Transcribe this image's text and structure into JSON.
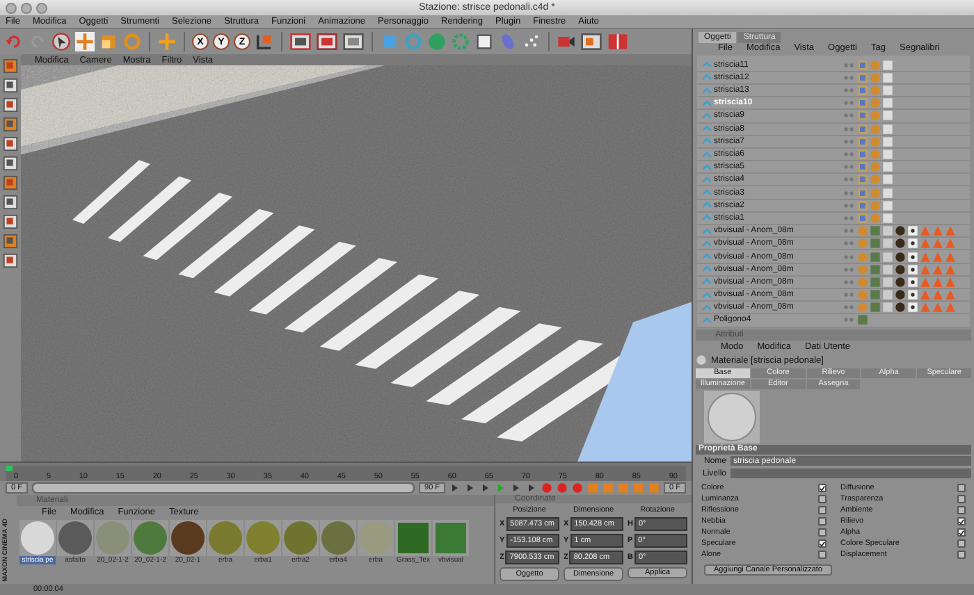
{
  "window": {
    "title": "Stazione: strisce pedonali.c4d *"
  },
  "menu": [
    "File",
    "Modifica",
    "Oggetti",
    "Strumenti",
    "Selezione",
    "Struttura",
    "Funzioni",
    "Animazione",
    "Personaggio",
    "Rendering",
    "Plugin",
    "Finestre",
    "Aiuto"
  ],
  "toolbar": {
    "axes": [
      "X",
      "Y",
      "Z"
    ]
  },
  "viewport": {
    "menu": [
      "Modifica",
      "Camere",
      "Mostra",
      "Filtro",
      "Vista"
    ]
  },
  "objects": {
    "tabs": [
      {
        "label": "Oggetti",
        "selected": true
      },
      {
        "label": "Struttura",
        "selected": false
      }
    ],
    "menu": [
      "File",
      "Modifica",
      "Vista",
      "Oggetti",
      "Tag",
      "Segnalibri"
    ],
    "rows": [
      {
        "name": "striscia11",
        "kind": "stripe",
        "selected": false
      },
      {
        "name": "striscia12",
        "kind": "stripe",
        "selected": false
      },
      {
        "name": "striscia13",
        "kind": "stripe",
        "selected": false
      },
      {
        "name": "striscia10",
        "kind": "stripe",
        "selected": true
      },
      {
        "name": "striscia9",
        "kind": "stripe",
        "selected": false
      },
      {
        "name": "striscia8",
        "kind": "stripe",
        "selected": false
      },
      {
        "name": "striscia7",
        "kind": "stripe",
        "selected": false
      },
      {
        "name": "striscia6",
        "kind": "stripe",
        "selected": false
      },
      {
        "name": "striscia5",
        "kind": "stripe",
        "selected": false
      },
      {
        "name": "striscia4",
        "kind": "stripe",
        "selected": false
      },
      {
        "name": "striscia3",
        "kind": "stripe",
        "selected": false
      },
      {
        "name": "striscia2",
        "kind": "stripe",
        "selected": false
      },
      {
        "name": "striscia1",
        "kind": "stripe",
        "selected": false
      },
      {
        "name": "vbvisual - Anom_08m",
        "kind": "plant",
        "selected": false
      },
      {
        "name": "vbvisual - Anom_08m",
        "kind": "plant",
        "selected": false
      },
      {
        "name": "vbvisual - Anom_08m",
        "kind": "plant",
        "selected": false
      },
      {
        "name": "vbvisual - Anom_08m",
        "kind": "plant",
        "selected": false
      },
      {
        "name": "vbvisual - Anom_08m",
        "kind": "plant",
        "selected": false
      },
      {
        "name": "vbvisual - Anom_08m",
        "kind": "plant",
        "selected": false
      },
      {
        "name": "vbvisual - Anom_08m",
        "kind": "plant",
        "selected": false
      },
      {
        "name": "Poligono4",
        "kind": "polygon",
        "selected": false
      }
    ]
  },
  "attributes": {
    "title": "Attributi",
    "menu": [
      "Modo",
      "Modifica",
      "Dati Utente"
    ],
    "heading": "Materiale [striscia pedonale]",
    "tabs": [
      {
        "label": "Base",
        "selected": true
      },
      {
        "label": "Colore",
        "selected": false
      },
      {
        "label": "Rilievo",
        "selected": false
      },
      {
        "label": "Alpha",
        "selected": false
      },
      {
        "label": "Speculare",
        "selected": false
      },
      {
        "label": "Illuminazione",
        "selected": false
      },
      {
        "label": "Editor",
        "selected": false
      },
      {
        "label": "Assegna",
        "selected": false
      }
    ],
    "section": "Proprietà Base",
    "name_label": "Nome",
    "name_value": "striscia pedonale",
    "layer_label": "Livello",
    "channels": [
      {
        "label": "Colore",
        "checked": true
      },
      {
        "label": "Diffusione",
        "checked": false
      },
      {
        "label": "Luminanza",
        "checked": false
      },
      {
        "label": "Trasparenza",
        "checked": false
      },
      {
        "label": "Riflessione",
        "checked": false
      },
      {
        "label": "Ambiente",
        "checked": false
      },
      {
        "label": "Nebbia",
        "checked": false
      },
      {
        "label": "Rilievo",
        "checked": true
      },
      {
        "label": "Normale",
        "checked": false
      },
      {
        "label": "Alpha",
        "checked": true
      },
      {
        "label": "Speculare",
        "checked": true
      },
      {
        "label": "Colore Speculare",
        "checked": false
      },
      {
        "label": "Alone",
        "checked": false
      },
      {
        "label": "Displacement",
        "checked": false
      }
    ],
    "button": "Aggiungi Canale Personalizzato"
  },
  "timeline": {
    "ticks": [
      "0",
      "5",
      "10",
      "15",
      "20",
      "25",
      "30",
      "35",
      "40",
      "45",
      "50",
      "55",
      "60",
      "65",
      "70",
      "75",
      "80",
      "85",
      "90"
    ],
    "level": 0,
    "range": {
      "level": 1
    },
    "start": "0 F",
    "end": "90 F",
    "current": "0 F"
  },
  "materials": {
    "title": "Materiali",
    "menu": [
      "File",
      "Modifica",
      "Funzione",
      "Texture"
    ],
    "items": [
      {
        "label": "striscia pe",
        "color": "#d8d8d8",
        "selected": true
      },
      {
        "label": "asfalto",
        "color": "#5a5a5a",
        "selected": false
      },
      {
        "label": "20_02-1-2",
        "color": "#8a8f7a",
        "selected": false
      },
      {
        "label": "20_02-1-2",
        "color": "#4f7a3e",
        "selected": false
      },
      {
        "label": "20_02-1",
        "color": "#5a3a1e",
        "selected": false
      },
      {
        "label": "erba",
        "color": "#7a7a30",
        "selected": false
      },
      {
        "label": "erba1",
        "color": "#80802e",
        "selected": false
      },
      {
        "label": "erba2",
        "color": "#6e7430",
        "selected": false
      },
      {
        "label": "erba4",
        "color": "#6a7040",
        "selected": false
      },
      {
        "label": "erba",
        "color": "#9a9a80",
        "selected": false
      },
      {
        "label": "Grass_Tex",
        "color": "#2f6a25",
        "selected": false
      },
      {
        "label": "vbvisual",
        "color": "#3a7a35",
        "selected": false
      }
    ]
  },
  "coordinates": {
    "title": "Coordinate",
    "headers": [
      "Posizione",
      "Dimensione",
      "Rotazione"
    ],
    "rows": [
      [
        {
          "axis": "X",
          "value": "5087.473 cm"
        },
        {
          "axis": "X",
          "value": "150.428 cm"
        },
        {
          "axis": "H",
          "value": "0°"
        }
      ],
      [
        {
          "axis": "Y",
          "value": "-153.108 cm"
        },
        {
          "axis": "Y",
          "value": "1 cm"
        },
        {
          "axis": "P",
          "value": "0°"
        }
      ],
      [
        {
          "axis": "Z",
          "value": "7900.533 cm"
        },
        {
          "axis": "Z",
          "value": "80.208 cm"
        },
        {
          "axis": "B",
          "value": "0°"
        }
      ]
    ],
    "mode": "Oggetto",
    "size_mode": "Dimensione",
    "apply": "Applica"
  },
  "logo": "MAXON CINEMA 4D",
  "status": "00:00:04"
}
